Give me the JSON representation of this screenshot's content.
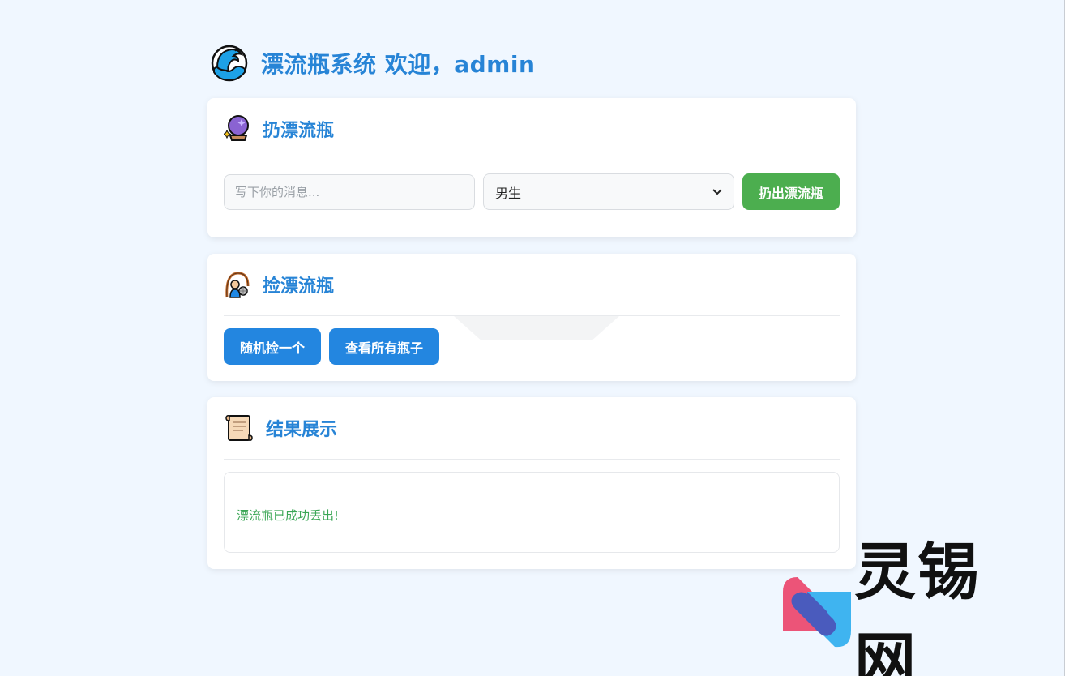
{
  "header": {
    "title": "漂流瓶系统 欢迎，admin",
    "icon": "wave-icon"
  },
  "throw_card": {
    "title": "扔漂流瓶",
    "icon": "crystal-ball-icon",
    "message_placeholder": "写下你的消息...",
    "message_value": "",
    "gender_selected": "男生",
    "submit_label": "扔出漂流瓶"
  },
  "pick_card": {
    "title": "捡漂流瓶",
    "icon": "fishing-person-icon",
    "random_label": "随机捡一个",
    "view_all_label": "查看所有瓶子"
  },
  "result_card": {
    "title": "结果展示",
    "icon": "scroll-icon",
    "message": "漂流瓶已成功丢出!"
  },
  "watermark": {
    "text": "灵锡网"
  },
  "colors": {
    "background": "#f0f7ff",
    "accent": "#2784d6",
    "green_button": "#4cae4f",
    "blue_button": "#2386e0",
    "success_text": "#3aa655"
  }
}
